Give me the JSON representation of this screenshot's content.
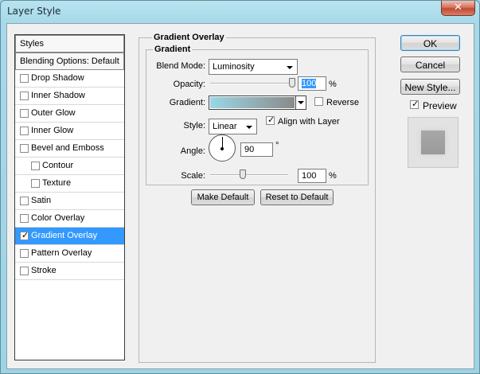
{
  "window": {
    "title": "Layer Style",
    "close_glyph": "✕"
  },
  "styles_list": {
    "header": "Styles",
    "blending_options": "Blending Options: Default",
    "items": [
      {
        "label": "Drop Shadow",
        "checked": false,
        "indent": false,
        "selected": false
      },
      {
        "label": "Inner Shadow",
        "checked": false,
        "indent": false,
        "selected": false
      },
      {
        "label": "Outer Glow",
        "checked": false,
        "indent": false,
        "selected": false
      },
      {
        "label": "Inner Glow",
        "checked": false,
        "indent": false,
        "selected": false
      },
      {
        "label": "Bevel and Emboss",
        "checked": false,
        "indent": false,
        "selected": false
      },
      {
        "label": "Contour",
        "checked": false,
        "indent": true,
        "selected": false
      },
      {
        "label": "Texture",
        "checked": false,
        "indent": true,
        "selected": false
      },
      {
        "label": "Satin",
        "checked": false,
        "indent": false,
        "selected": false
      },
      {
        "label": "Color Overlay",
        "checked": false,
        "indent": false,
        "selected": false
      },
      {
        "label": "Gradient Overlay",
        "checked": true,
        "indent": false,
        "selected": true
      },
      {
        "label": "Pattern Overlay",
        "checked": false,
        "indent": false,
        "selected": false
      },
      {
        "label": "Stroke",
        "checked": false,
        "indent": false,
        "selected": false
      }
    ]
  },
  "gradient_overlay": {
    "title": "Gradient Overlay",
    "group": "Gradient",
    "blend_mode_label": "Blend Mode:",
    "blend_mode": "Luminosity",
    "opacity_label": "Opacity:",
    "opacity": "100",
    "opacity_unit": "%",
    "opacity_level": 1.0,
    "gradient_label": "Gradient:",
    "gradient_colors": [
      "#9ad7e6",
      "#8a8a8a"
    ],
    "reverse_label": "Reverse",
    "reverse_checked": false,
    "style_label": "Style:",
    "style": "Linear",
    "align_label": "Align with Layer",
    "align_checked": true,
    "angle_label": "Angle:",
    "angle": "90",
    "angle_unit": "°",
    "scale_label": "Scale:",
    "scale": "100",
    "scale_unit": "%",
    "scale_level": 0.42,
    "make_default": "Make Default",
    "reset_default": "Reset to Default"
  },
  "actions": {
    "ok": "OK",
    "cancel": "Cancel",
    "new_style": "New Style...",
    "preview_label": "Preview",
    "preview_checked": true
  }
}
